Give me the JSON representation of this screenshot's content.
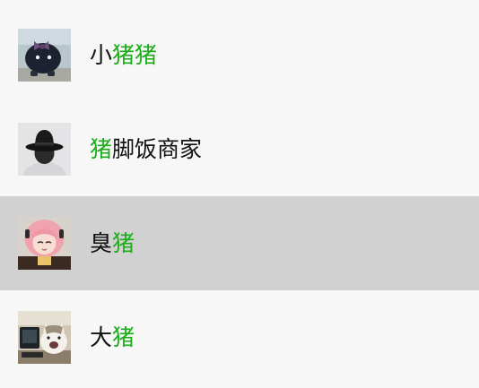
{
  "colors": {
    "background": "#f7f7f7",
    "selected_row": "#d1d1d1",
    "text": "#111111",
    "highlight": "#1aad19"
  },
  "search_results": [
    {
      "avatar": "dark-creature-with-bow-avatar",
      "name_before": "小",
      "name_match": "猪猪",
      "name_after": ""
    },
    {
      "avatar": "black-hat-person-avatar",
      "name_before": "",
      "name_match": "猪",
      "name_after": "脚饭商家"
    },
    {
      "avatar": "pink-haired-anime-girl-avatar",
      "name_before": "臭",
      "name_match": "猪",
      "name_after": "",
      "selected": true
    },
    {
      "avatar": "cat-at-computer-avatar",
      "name_before": "大",
      "name_match": "猪",
      "name_after": ""
    }
  ]
}
